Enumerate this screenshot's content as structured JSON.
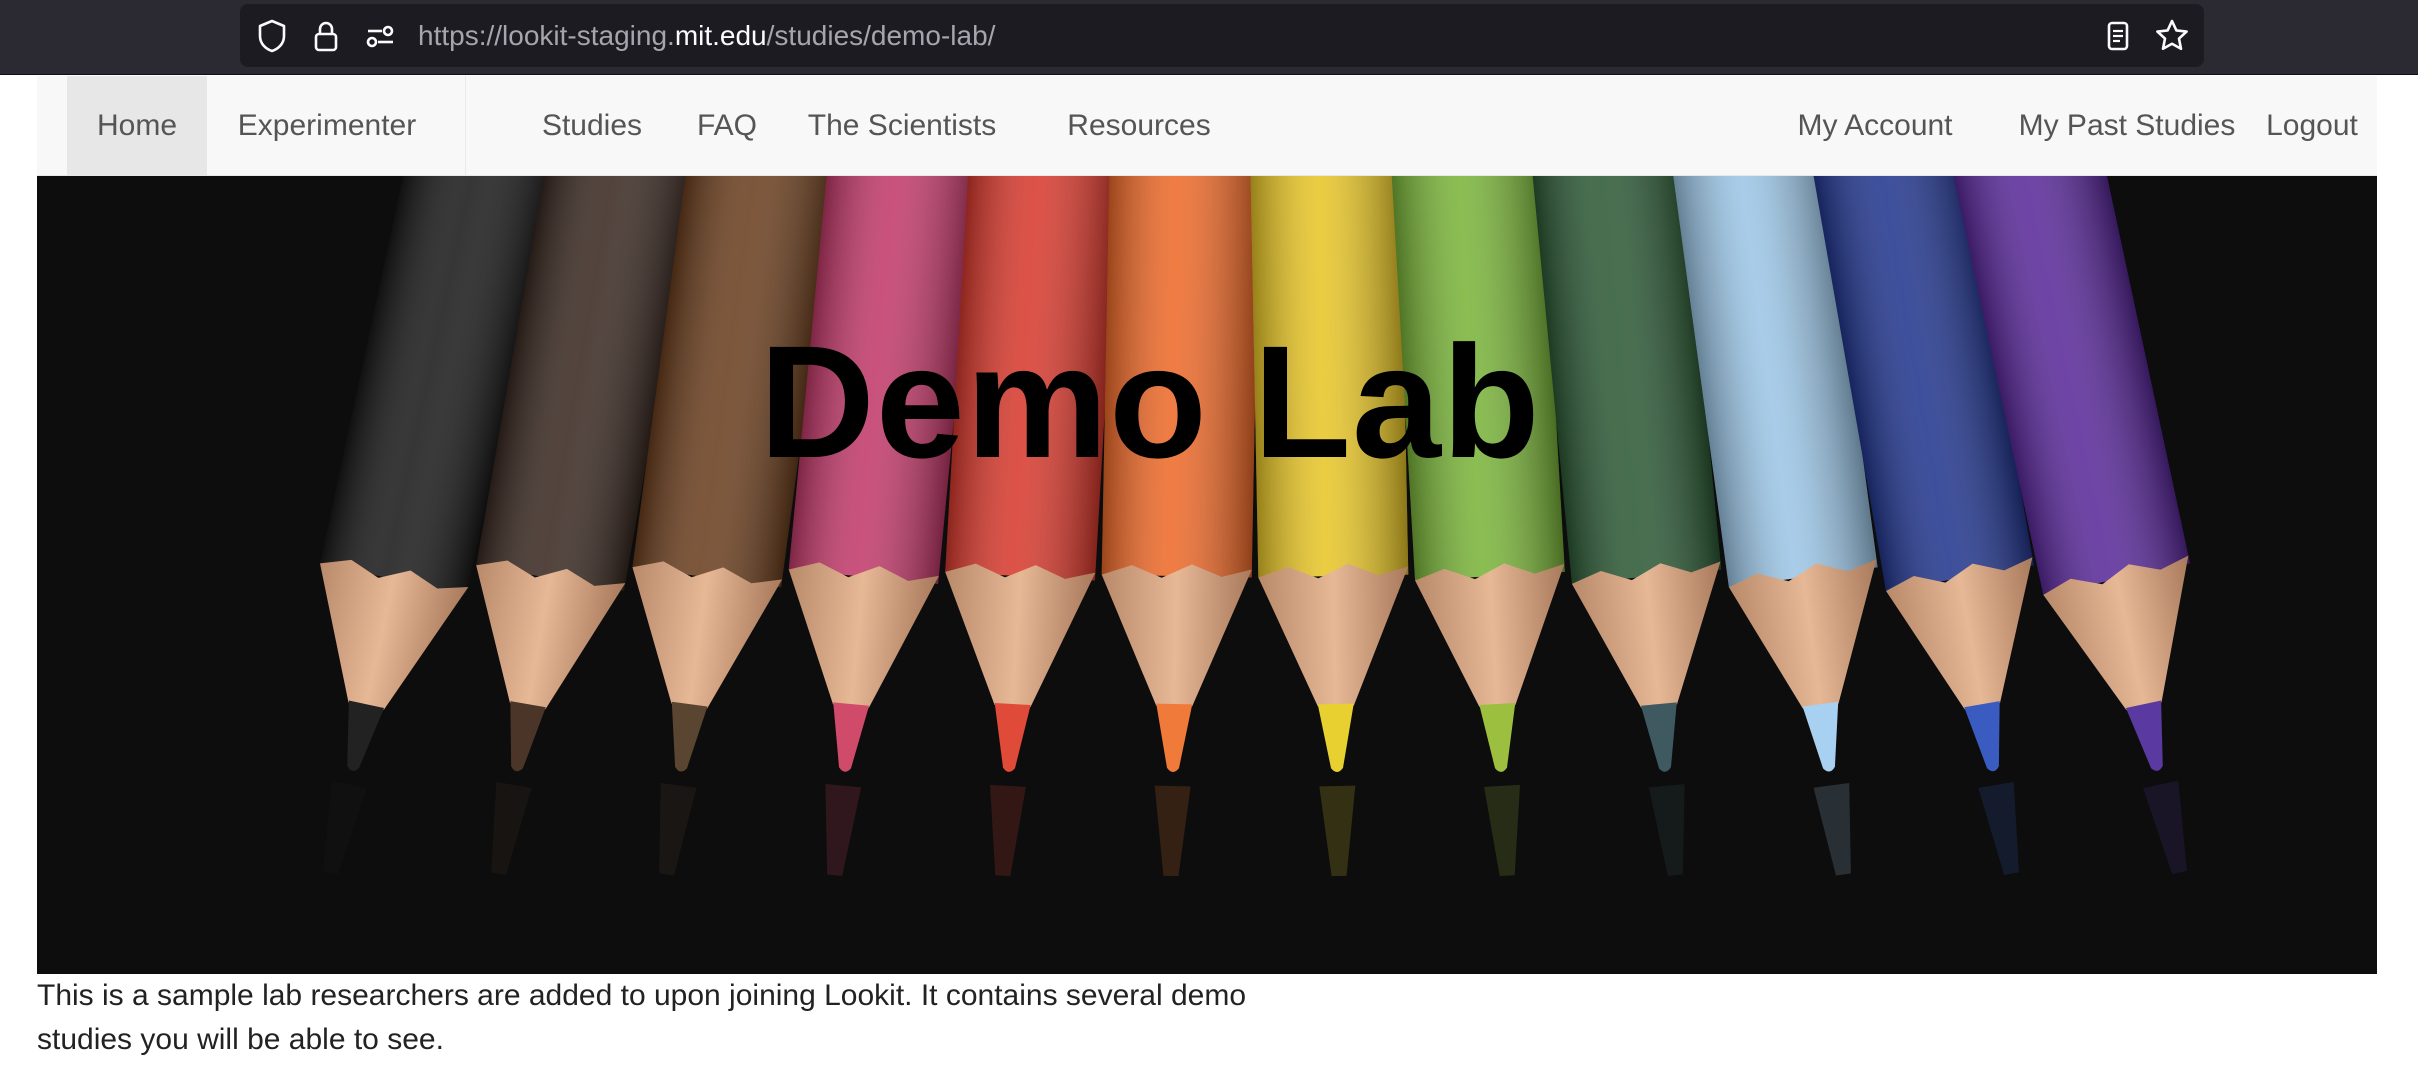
{
  "browser": {
    "url_prefix": "https://lookit-staging.",
    "url_host": "mit.edu",
    "url_path": "/studies/demo-lab/",
    "icons": [
      "shield-icon",
      "lock-icon",
      "permissions-icon",
      "reader-view-icon",
      "bookmark-star-icon"
    ]
  },
  "nav": {
    "left_items": [
      {
        "label": "Home",
        "active": true
      },
      {
        "label": "Experimenter"
      },
      {
        "label": "Studies"
      },
      {
        "label": "FAQ"
      },
      {
        "label": "The Scientists"
      },
      {
        "label": "Resources"
      }
    ],
    "right_items": [
      {
        "label": "My Account"
      },
      {
        "label": "My Past Studies"
      },
      {
        "label": "Logout"
      }
    ]
  },
  "hero": {
    "title": "Demo Lab",
    "pencil_colors": [
      "#1a1a1a",
      "#3a2a22",
      "#6b3f1f",
      "#c23a6a",
      "#d83a2e",
      "#ee6a2a",
      "#e8c628",
      "#7ab43a",
      "#2d5a36",
      "#9cc6e6",
      "#23378f",
      "#5a2a9a"
    ],
    "tip_colors": [
      "#222222",
      "#4a3528",
      "#5a4530",
      "#d04a6a",
      "#e04a38",
      "#f07a3a",
      "#e8d030",
      "#9cbf40",
      "#3e5a60",
      "#a8d0f0",
      "#3a5cc0",
      "#5a3aa0"
    ]
  },
  "description": {
    "text": "This is a sample lab researchers are added to upon joining Lookit. It contains several demo studies you will be able to see."
  }
}
